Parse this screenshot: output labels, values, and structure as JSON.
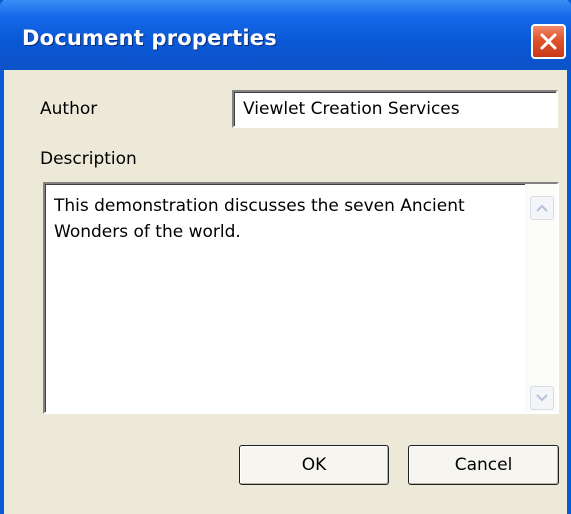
{
  "window": {
    "title": "Document properties"
  },
  "icons": {
    "close": "close-icon",
    "scroll_up": "scroll-up-arrow-icon",
    "scroll_down": "scroll-down-arrow-icon"
  },
  "form": {
    "author_label": "Author",
    "author_value": "Viewlet Creation Services",
    "description_label": "Description",
    "description_value": "This demonstration discusses the seven Ancient Wonders of the world."
  },
  "buttons": {
    "ok_label": "OK",
    "cancel_label": "Cancel"
  },
  "colors": {
    "titlebar": "#0a58d6",
    "window_face": "#ece9d8",
    "close_button": "#e0532c"
  }
}
